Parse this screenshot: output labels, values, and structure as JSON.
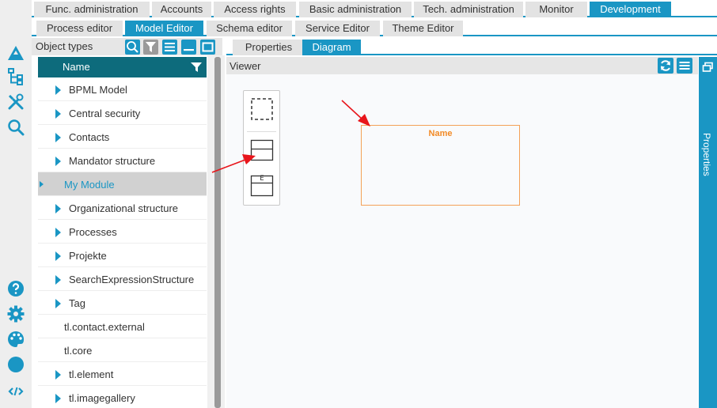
{
  "top_tabs": [
    {
      "label": "Func. administration",
      "active": false
    },
    {
      "label": "Accounts",
      "active": false
    },
    {
      "label": "Access rights",
      "active": false
    },
    {
      "label": "Basic administration",
      "active": false
    },
    {
      "label": "Tech. administration",
      "active": false
    },
    {
      "label": "Monitor",
      "active": false
    },
    {
      "label": "Development",
      "active": true
    }
  ],
  "sub_tabs": [
    {
      "label": "Process editor",
      "active": false
    },
    {
      "label": "Model Editor",
      "active": true
    },
    {
      "label": "Schema editor",
      "active": false
    },
    {
      "label": "Service Editor",
      "active": false
    },
    {
      "label": "Theme Editor",
      "active": false
    }
  ],
  "object_types": {
    "title": "Object types",
    "column_header": "Name",
    "items": [
      {
        "label": "BPML Model",
        "expandable": true
      },
      {
        "label": "Central security",
        "expandable": true
      },
      {
        "label": "Contacts",
        "expandable": true
      },
      {
        "label": "Mandator structure",
        "expandable": true
      },
      {
        "label": "My Module",
        "expandable": true,
        "selected": true
      },
      {
        "label": "Organizational structure",
        "expandable": true
      },
      {
        "label": "Processes",
        "expandable": true
      },
      {
        "label": "Projekte",
        "expandable": true
      },
      {
        "label": "SearchExpressionStructure",
        "expandable": true
      },
      {
        "label": "Tag",
        "expandable": true
      },
      {
        "label": "tl.contact.external",
        "expandable": false
      },
      {
        "label": "tl.core",
        "expandable": false
      },
      {
        "label": "tl.element",
        "expandable": true
      },
      {
        "label": "tl.imagegallery",
        "expandable": true
      }
    ]
  },
  "detail_tabs": [
    {
      "label": "Properties",
      "active": false
    },
    {
      "label": "Diagram",
      "active": true
    }
  ],
  "viewer": {
    "title": "Viewer",
    "palette": [
      "selection-tool-icon",
      "class-shape-icon",
      "enum-shape-icon"
    ],
    "palette_enum_glyph": "E",
    "node_label": "Name"
  },
  "properties_sidebar": {
    "label": "Properties"
  },
  "colors": {
    "accent": "#1a96c4",
    "header_dark": "#0d6b7c",
    "node_border": "#f4a157",
    "node_text": "#f28a26",
    "annotation_arrow": "#e8151b"
  }
}
